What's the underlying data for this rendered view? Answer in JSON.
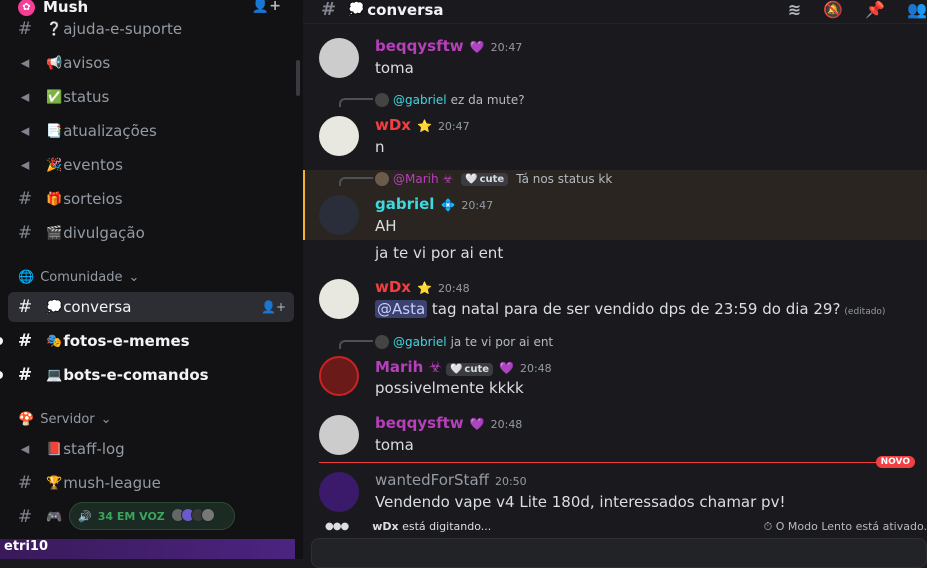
{
  "server": {
    "name": "Mush",
    "logo": "flower-icon"
  },
  "channels_top": [
    {
      "label": "ajuda-e-suporte",
      "emoji": "❔",
      "icon": "hash-icon"
    },
    {
      "label": "avisos",
      "emoji": "📢",
      "icon": "megaphone-icon"
    },
    {
      "label": "status",
      "emoji": "✅",
      "icon": "megaphone-icon"
    },
    {
      "label": "atualizações",
      "emoji": "📑",
      "icon": "megaphone-icon"
    },
    {
      "label": "eventos",
      "emoji": "🎉",
      "icon": "megaphone-icon"
    },
    {
      "label": "sorteios",
      "emoji": "🎁",
      "icon": "hash-icon"
    },
    {
      "label": "divulgação",
      "emoji": "🎬",
      "icon": "hash-icon"
    }
  ],
  "categories": {
    "comunidade": "Comunidade",
    "servidor": "Servidor"
  },
  "channels_comunidade": [
    {
      "label": "conversa",
      "emoji": "💭"
    },
    {
      "label": "fotos-e-memes",
      "emoji": "🎭"
    },
    {
      "label": "bots-e-comandos",
      "emoji": "💻"
    }
  ],
  "channels_servidor": [
    {
      "label": "staff-log",
      "emoji": "📕"
    },
    {
      "label": "mush-league",
      "emoji": "🏆"
    },
    {
      "label": "",
      "emoji": "🎮"
    }
  ],
  "voice": {
    "label": "34 EM VOZ"
  },
  "user_banner": {
    "text": "etri10"
  },
  "topbar": {
    "channel": "conversa",
    "emoji": "💭"
  },
  "messages": [
    {
      "author": "beqqysftw",
      "time": "20:47",
      "text": "toma",
      "color": "#b640b9"
    },
    {
      "reply_to": "@gabriel",
      "reply_text": "ez da mute?",
      "author": "wDx",
      "time": "20:47",
      "text": "n",
      "color": "#f23f43"
    },
    {
      "reply_to": "@Marih ☣",
      "reply_tag": "cute",
      "reply_text": "Tá nos status kk",
      "author": "gabriel",
      "time": "20:47",
      "text": "AH",
      "text2": "ja te vi por ai ent",
      "color": "#3fd7e0"
    },
    {
      "author": "wDx",
      "time": "20:48",
      "mention": "@Asta",
      "text": " tag natal para de ser vendido dps de 23:59 do dia 29?",
      "edited": "(editado)",
      "color": "#f23f43"
    },
    {
      "reply_to": "@gabriel",
      "reply_text": "ja te vi por ai ent",
      "author": "Marih ☣",
      "tag": "cute",
      "time": "20:48",
      "text": "possivelmente kkkk",
      "color": "#b640b9"
    },
    {
      "author": "beqqysftw",
      "time": "20:48",
      "text": "toma",
      "color": "#b640b9"
    },
    {
      "author": "wantedForStaff",
      "time": "20:50",
      "text": "Vendendo vape v4 Lite 180d, interessados chamar pv!",
      "color": "#949ba4"
    }
  ],
  "new_label": "NOVO",
  "typing": {
    "user": "wDx",
    "text": " está digitando..."
  },
  "slow_mode": "O Modo Lento está ativado."
}
